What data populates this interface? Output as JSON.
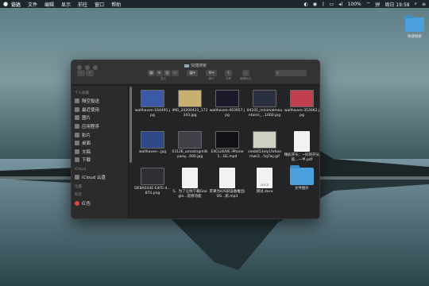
{
  "menubar": {
    "app_name": "访达",
    "items": [
      "文件",
      "编辑",
      "显示",
      "前往",
      "窗口",
      "帮助"
    ],
    "battery": "100%",
    "clock": "周日 19:58"
  },
  "desktop": {
    "folder_label": "快速搜索"
  },
  "window": {
    "title": "快捷搜索",
    "toolbar_labels": [
      "显示",
      "操作",
      "共享",
      "编辑标记"
    ],
    "sidebar": {
      "section_personal": "个人收藏",
      "favorites": [
        {
          "label": "隔空投送",
          "icon": "airdrop-icon"
        },
        {
          "label": "最近使用",
          "icon": "clock-icon"
        },
        {
          "label": "图片",
          "icon": "photos-icon"
        },
        {
          "label": "应用程序",
          "icon": "apps-icon"
        },
        {
          "label": "影片",
          "icon": "movie-icon"
        },
        {
          "label": "桌面",
          "icon": "desktop-icon"
        },
        {
          "label": "文稿",
          "icon": "document-icon"
        },
        {
          "label": "下载",
          "icon": "download-icon"
        }
      ],
      "section_icloud": "iCloud",
      "icloud_items": [
        {
          "label": "iCloud 云盘",
          "icon": "cloud-icon"
        }
      ],
      "section_locations": "位置",
      "section_tags": "标签",
      "tags": [
        {
          "label": "红色",
          "color": "#e0453a"
        }
      ]
    },
    "files": [
      {
        "name": "wallhaven-164491.jpg",
        "kind": "image",
        "color": "#3a5aa8"
      },
      {
        "name": "IMG_20200421_173343.jpg",
        "kind": "image",
        "color": "#c8b070"
      },
      {
        "name": "wallhaven-403957.jpg",
        "kind": "image",
        "color": "#1a1a2a"
      },
      {
        "name": "04101_minimalmountains_...1600.jpg",
        "kind": "image",
        "color": "#2a3040"
      },
      {
        "name": "wallhaven-353062.jpg",
        "kind": "image",
        "color": "#c04050"
      },
      {
        "name": "wallhaven-..jpg",
        "kind": "image",
        "color": "#2c4a88"
      },
      {
        "name": "03126_amazingmilkyway...600.jpg",
        "kind": "image",
        "color": "#404048"
      },
      {
        "name": "EXCLUSIVE iPhone 1...GE.mp4",
        "kind": "image",
        "color": "#101015"
      },
      {
        "name": "ceeb653ely1fohoamwr2...5q7wj.gif",
        "kind": "image",
        "color": "#d0d0c0"
      },
      {
        "name": "精彩开头：~好的开头就...一半.pdf",
        "kind": "doc",
        "tag": ""
      },
      {
        "name": "DEBA034E-E4FE-4...874.png",
        "kind": "image",
        "color": "#303034"
      },
      {
        "name": "5、为了让你下载Google...装修功能",
        "kind": "doc",
        "tag": ""
      },
      {
        "name": "苹果为iOS旧设备推出iOS...新.mp3",
        "kind": "doc",
        "tag": ""
      },
      {
        "name": "测试.docx",
        "kind": "doc",
        "tag": "DOCX"
      },
      {
        "name": "文件图片",
        "kind": "folder"
      }
    ]
  }
}
